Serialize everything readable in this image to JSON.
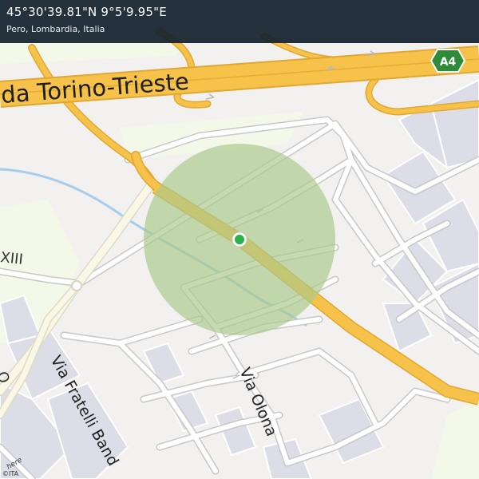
{
  "header": {
    "coordinates": "45°30'39.81\"N 9°5'9.95\"E",
    "place": "Pero, Lombardia, Italia"
  },
  "map": {
    "labels": {
      "highway_name": "da Torino-Trieste",
      "highway_shield": "A4",
      "road_left": "XIII",
      "road_left_fragment": "O",
      "via_olona": "Via Olona",
      "via_fratelli": "Via Fratelli Band"
    },
    "attribution": "©ITA",
    "logo_text": "here",
    "colors": {
      "background": "#f2f1ef",
      "building": "#dcdde7",
      "park": "#f3f8e8",
      "highway": "#f6c24a",
      "highway_casing": "#e0a733",
      "secondary_road": "#fbf7e6",
      "street": "#ffffff",
      "street_casing": "#c8c8c8",
      "river": "#a8cdea",
      "radius_fill": "#a9c98a",
      "marker": "#2bb34b",
      "shield": "#2e8b3a"
    }
  }
}
